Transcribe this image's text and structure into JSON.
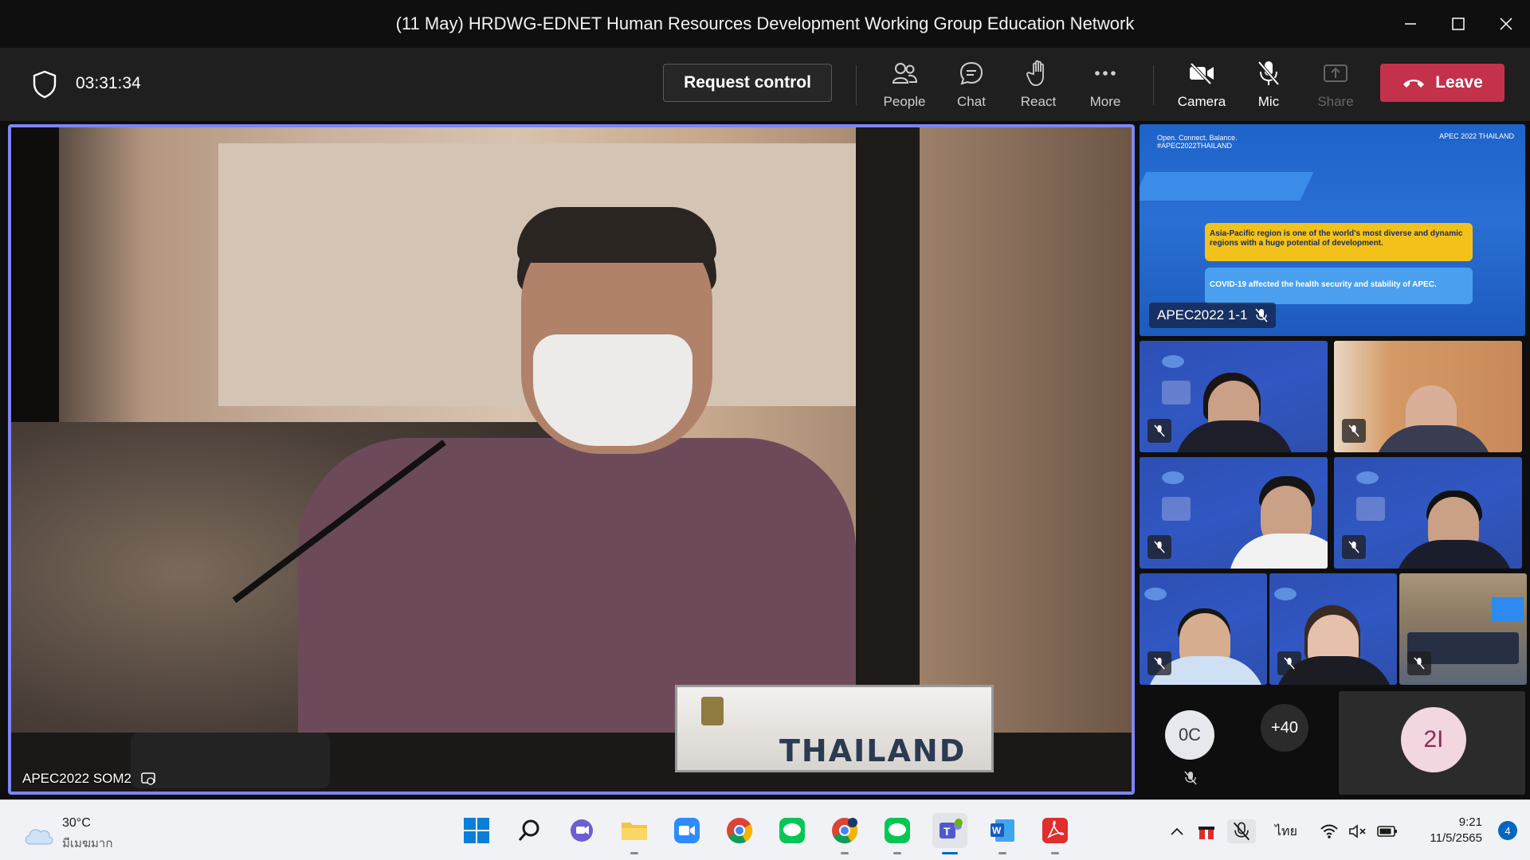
{
  "window": {
    "title": "(11 May) HRDWG-EDNET Human Resources Development Working Group Education Network"
  },
  "toolbar": {
    "timer": "03:31:34",
    "request_control": "Request control",
    "people": "People",
    "chat": "Chat",
    "react": "React",
    "more": "More",
    "camera": "Camera",
    "mic": "Mic",
    "share": "Share",
    "leave": "Leave",
    "leave_color": "#c4314b"
  },
  "main_video": {
    "participant": "APEC2022 SOM2",
    "nameplate": "THAILAND",
    "highlight_color": "#7f85f5"
  },
  "presentation_tile": {
    "participant": "APEC2022 1-1",
    "slide_tagline": "Open. Connect. Balance.",
    "slide_hashtag": "#APEC2022THAILAND",
    "slide_box1": "Asia-Pacific region is one of the world's most diverse and dynamic regions with a huge potential of development.",
    "slide_box2": "COVID-19 affected the health security and stability of APEC.",
    "slide_logo": "APEC 2022 THAILAND"
  },
  "overflow": {
    "avatar1_initials": "0C",
    "more_count": "+40",
    "avatar2_initials": "2I"
  },
  "taskbar": {
    "weather_temp": "30°C",
    "weather_desc": "มีเมฆมาก",
    "language": "ไทย",
    "time": "9:21",
    "date": "11/5/2565",
    "notification_count": "4"
  }
}
